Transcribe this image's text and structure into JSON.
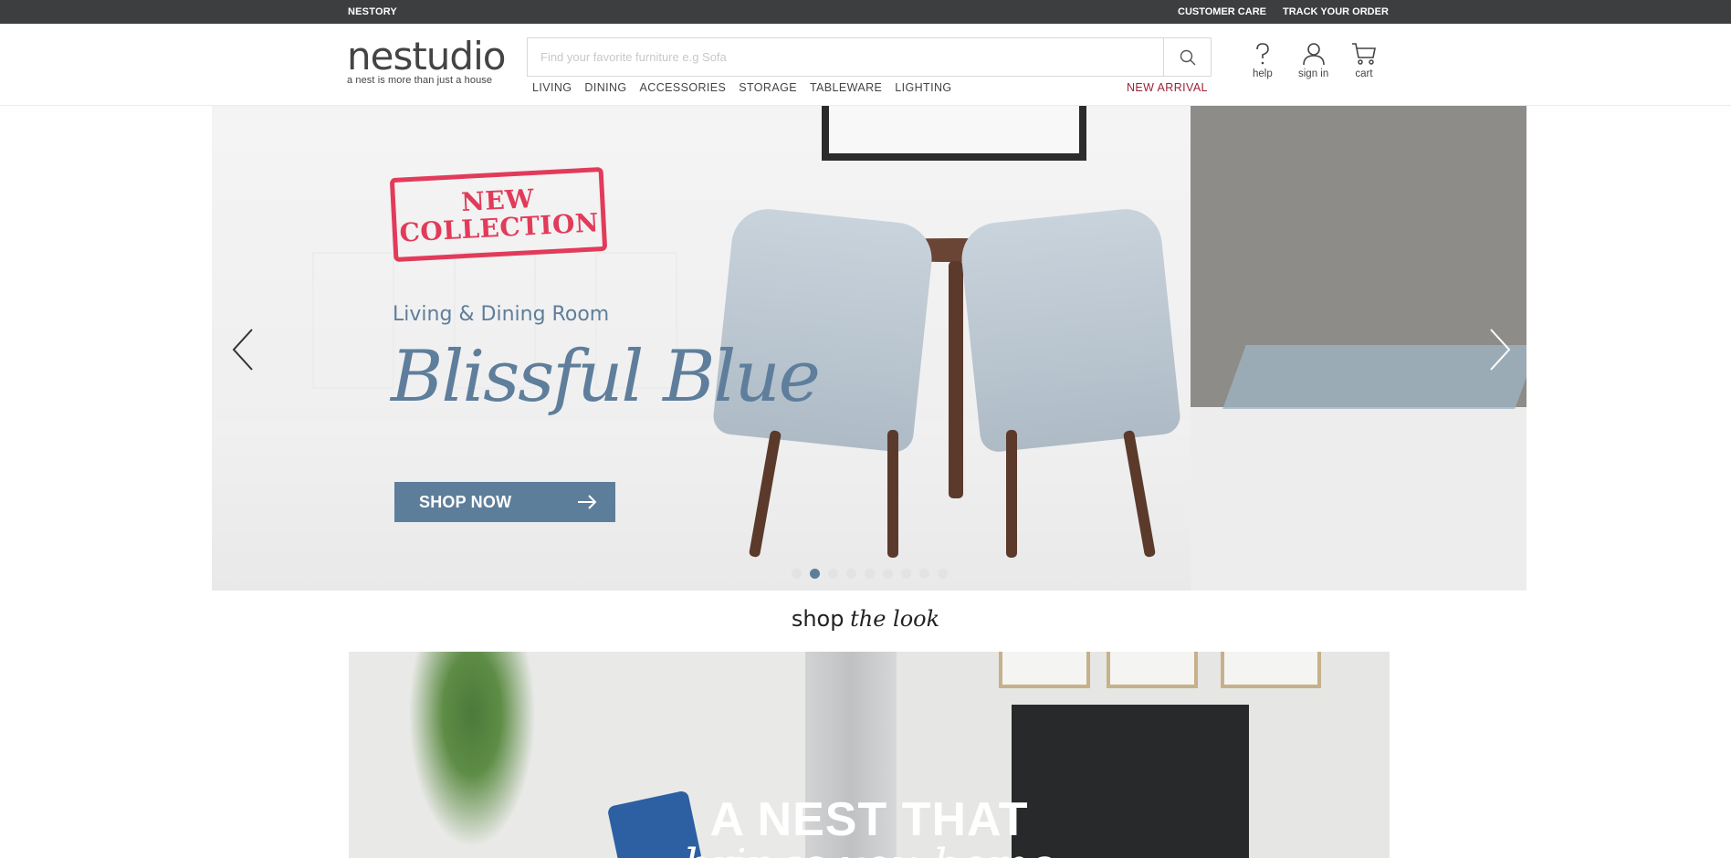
{
  "topbar": {
    "brand": "NESTORY",
    "customer_care": "CUSTOMER CARE",
    "track_order": "TRACK YOUR ORDER"
  },
  "header": {
    "logo_name": "nestudio",
    "logo_tagline": "a nest is more than just a house",
    "search_placeholder": "Find your favorite furniture e.g Sofa",
    "nav": [
      "LIVING",
      "DINING",
      "ACCESSORIES",
      "STORAGE",
      "TABLEWARE",
      "LIGHTING"
    ],
    "new_arrival": "NEW ARRIVAL",
    "icons": {
      "help": "help",
      "sign_in": "sign in",
      "cart": "cart"
    }
  },
  "hero": {
    "stamp": "NEW\nCOLLECTION",
    "subtitle": "Living & Dining Room",
    "script_title": "Blissful Blue",
    "cta": "SHOP NOW",
    "slide_count": 9,
    "active_slide": 2
  },
  "shop_the_look": {
    "part1": "shop",
    "part2": "the look",
    "headline": "A NEST THAT",
    "subline": "brings you home"
  },
  "colors": {
    "topbar_bg": "#3d3e40",
    "accent_blue": "#5d7e9b",
    "new_arrival_red": "#9b2335",
    "stamp_red": "#e23b5a"
  }
}
